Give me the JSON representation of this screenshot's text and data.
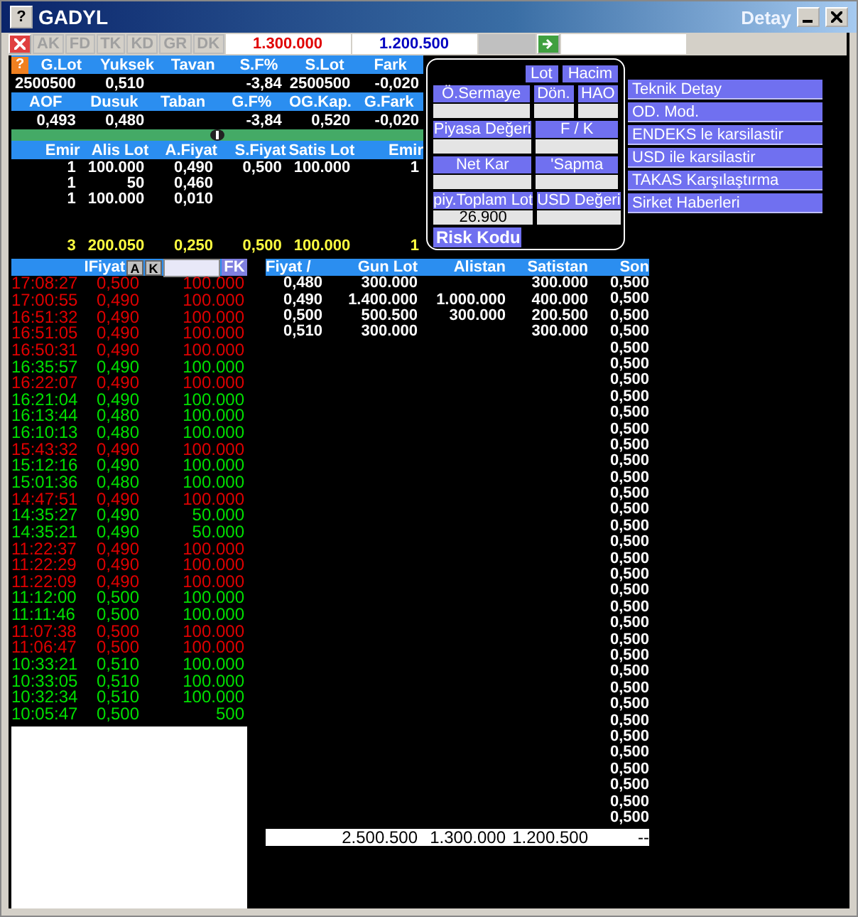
{
  "window": {
    "help_icon": "?",
    "title": "GADYL",
    "subtitle": "Detay"
  },
  "stats_help_icon": "?",
  "toolbar": {
    "buttons": [
      {
        "label": "AK",
        "disabled": true
      },
      {
        "label": "FD",
        "disabled": true
      },
      {
        "label": "TK",
        "disabled": true
      },
      {
        "label": "KD",
        "disabled": true
      },
      {
        "label": "GR",
        "disabled": true
      },
      {
        "label": "DK",
        "disabled": true
      }
    ],
    "bid_value": "1.300.000",
    "ask_value": "1.200.500"
  },
  "stats": [
    [
      {
        "header": "G.Lot",
        "value": "2500500"
      },
      {
        "header": "Yuksek",
        "value": "0,510"
      },
      {
        "header": "Tavan"
      },
      {
        "header": "S.F%",
        "value": "-3,84"
      },
      {
        "header": "S.Lot",
        "value": "2500500"
      },
      {
        "header": "Fark",
        "value": "-0,020"
      }
    ],
    [
      {
        "header": "AOF",
        "value": "0,493"
      },
      {
        "header": "Dusuk",
        "value": "0,480"
      },
      {
        "header": "Taban"
      },
      {
        "header": "G.F%",
        "value": "-3,84"
      },
      {
        "header": "OG.Kap.",
        "value": "0,520"
      },
      {
        "header": "G.Fark",
        "value": "-0,020"
      }
    ]
  ],
  "order_book": {
    "columns": [
      "Emir",
      "Alis Lot",
      "A.Fiyat",
      "S.Fiyat",
      "Satis Lot",
      "Emir"
    ],
    "rows": [
      [
        "1",
        "100.000",
        "0,490",
        "0,500",
        "100.000",
        "1"
      ],
      [
        "1",
        "50",
        "0,460",
        "",
        "",
        ""
      ],
      [
        "1",
        "100.000",
        "0,010",
        "",
        "",
        ""
      ]
    ],
    "total": [
      "3",
      "200.050",
      "0,250",
      "0,500",
      "100.000",
      "1"
    ]
  },
  "info_panel": {
    "tabs": [
      {
        "label": "Lot"
      },
      {
        "label": "Hacim"
      }
    ],
    "field_rows": [
      [
        {
          "label": "Ö.Sermaye"
        },
        {
          "label": "Dön."
        },
        {
          "label": "HAO"
        }
      ],
      [
        {
          "label": "Piyasa Değeri"
        },
        {
          "label": "F / K"
        }
      ],
      [
        {
          "label": "Net Kar"
        },
        {
          "label": "'Sapma"
        }
      ],
      [
        {
          "label": "piy.Toplam Lot",
          "value": "26.900"
        },
        {
          "label": "USD Değeri"
        }
      ]
    ],
    "risk_label": "Risk Kodu"
  },
  "links": [
    "Teknik Detay",
    "OD. Mod.",
    "ENDEKS le karsilastir",
    "USD ile karsilastir",
    "TAKAS Karşılaştırma",
    "Sirket Haberleri"
  ],
  "trades": {
    "header": "IFiyat",
    "buttons": [
      "A",
      "K"
    ],
    "filter_button": "FK",
    "rows": [
      {
        "time": "17:08:27",
        "price": "0,500",
        "lot": "100.000",
        "color": "#e00000"
      },
      {
        "time": "17:00:55",
        "price": "0,490",
        "lot": "100.000",
        "color": "#e00000"
      },
      {
        "time": "16:51:32",
        "price": "0,490",
        "lot": "100.000",
        "color": "#e00000"
      },
      {
        "time": "16:51:05",
        "price": "0,490",
        "lot": "100.000",
        "color": "#e00000"
      },
      {
        "time": "16:50:31",
        "price": "0,490",
        "lot": "100.000",
        "color": "#e00000"
      },
      {
        "time": "16:35:57",
        "price": "0,490",
        "lot": "100.000",
        "color": "#00e000"
      },
      {
        "time": "16:22:07",
        "price": "0,490",
        "lot": "100.000",
        "color": "#e00000"
      },
      {
        "time": "16:21:04",
        "price": "0,490",
        "lot": "100.000",
        "color": "#00e000"
      },
      {
        "time": "16:13:44",
        "price": "0,480",
        "lot": "100.000",
        "color": "#00e000"
      },
      {
        "time": "16:10:13",
        "price": "0,480",
        "lot": "100.000",
        "color": "#00e000"
      },
      {
        "time": "15:43:32",
        "price": "0,490",
        "lot": "100.000",
        "color": "#e00000"
      },
      {
        "time": "15:12:16",
        "price": "0,490",
        "lot": "100.000",
        "color": "#00e000"
      },
      {
        "time": "15:01:36",
        "price": "0,480",
        "lot": "100.000",
        "color": "#00e000"
      },
      {
        "time": "14:47:51",
        "price": "0,490",
        "lot": "100.000",
        "color": "#e00000"
      },
      {
        "time": "14:35:27",
        "price": "0,490",
        "lot": "50.000",
        "color": "#00e000"
      },
      {
        "time": "14:35:21",
        "price": "0,490",
        "lot": "50.000",
        "color": "#00e000"
      },
      {
        "time": "11:22:37",
        "price": "0,490",
        "lot": "100.000",
        "color": "#e00000"
      },
      {
        "time": "11:22:29",
        "price": "0,490",
        "lot": "100.000",
        "color": "#e00000"
      },
      {
        "time": "11:22:09",
        "price": "0,490",
        "lot": "100.000",
        "color": "#e00000"
      },
      {
        "time": "11:12:00",
        "price": "0,500",
        "lot": "100.000",
        "color": "#00e000"
      },
      {
        "time": "11:11:46",
        "price": "0,500",
        "lot": "100.000",
        "color": "#00e000"
      },
      {
        "time": "11:07:38",
        "price": "0,500",
        "lot": "100.000",
        "color": "#e00000"
      },
      {
        "time": "11:06:47",
        "price": "0,500",
        "lot": "100.000",
        "color": "#e00000"
      },
      {
        "time": "10:33:21",
        "price": "0,510",
        "lot": "100.000",
        "color": "#00e000"
      },
      {
        "time": "10:33:05",
        "price": "0,510",
        "lot": "100.000",
        "color": "#00e000"
      },
      {
        "time": "10:32:34",
        "price": "0,510",
        "lot": "100.000",
        "color": "#00e000"
      },
      {
        "time": "10:05:47",
        "price": "0,500",
        "lot": "500",
        "color": "#00e000"
      }
    ]
  },
  "depth": {
    "columns": [
      "Fiyat /",
      "Gun Lot",
      "Alistan",
      "Satistan",
      "Son"
    ],
    "rows": [
      [
        "0,480",
        "300.000",
        "",
        "300.000"
      ],
      [
        "0,490",
        "1.400.000",
        "1.000.000",
        "400.000"
      ],
      [
        "0,500",
        "500.500",
        "300.000",
        "200.500"
      ],
      [
        "0,510",
        "300.000",
        "",
        "300.000"
      ]
    ],
    "last_prices": [
      "0,500",
      "0,500",
      "0,500",
      "0,500",
      "0,500",
      "0,500",
      "0,500",
      "0,500",
      "0,500",
      "0,500",
      "0,500",
      "0,500",
      "0,500",
      "0,500",
      "0,500",
      "0,500",
      "0,500",
      "0,500",
      "0,500",
      "0,500",
      "0,500",
      "0,500",
      "0,500",
      "0,500",
      "0,500",
      "0,500",
      "0,500",
      "0,500",
      "0,500",
      "0,500",
      "0,500",
      "0,500",
      "0,500",
      "0,500"
    ],
    "total": [
      "2.500.500",
      "1.300.000",
      "1.200.500",
      "--"
    ]
  }
}
